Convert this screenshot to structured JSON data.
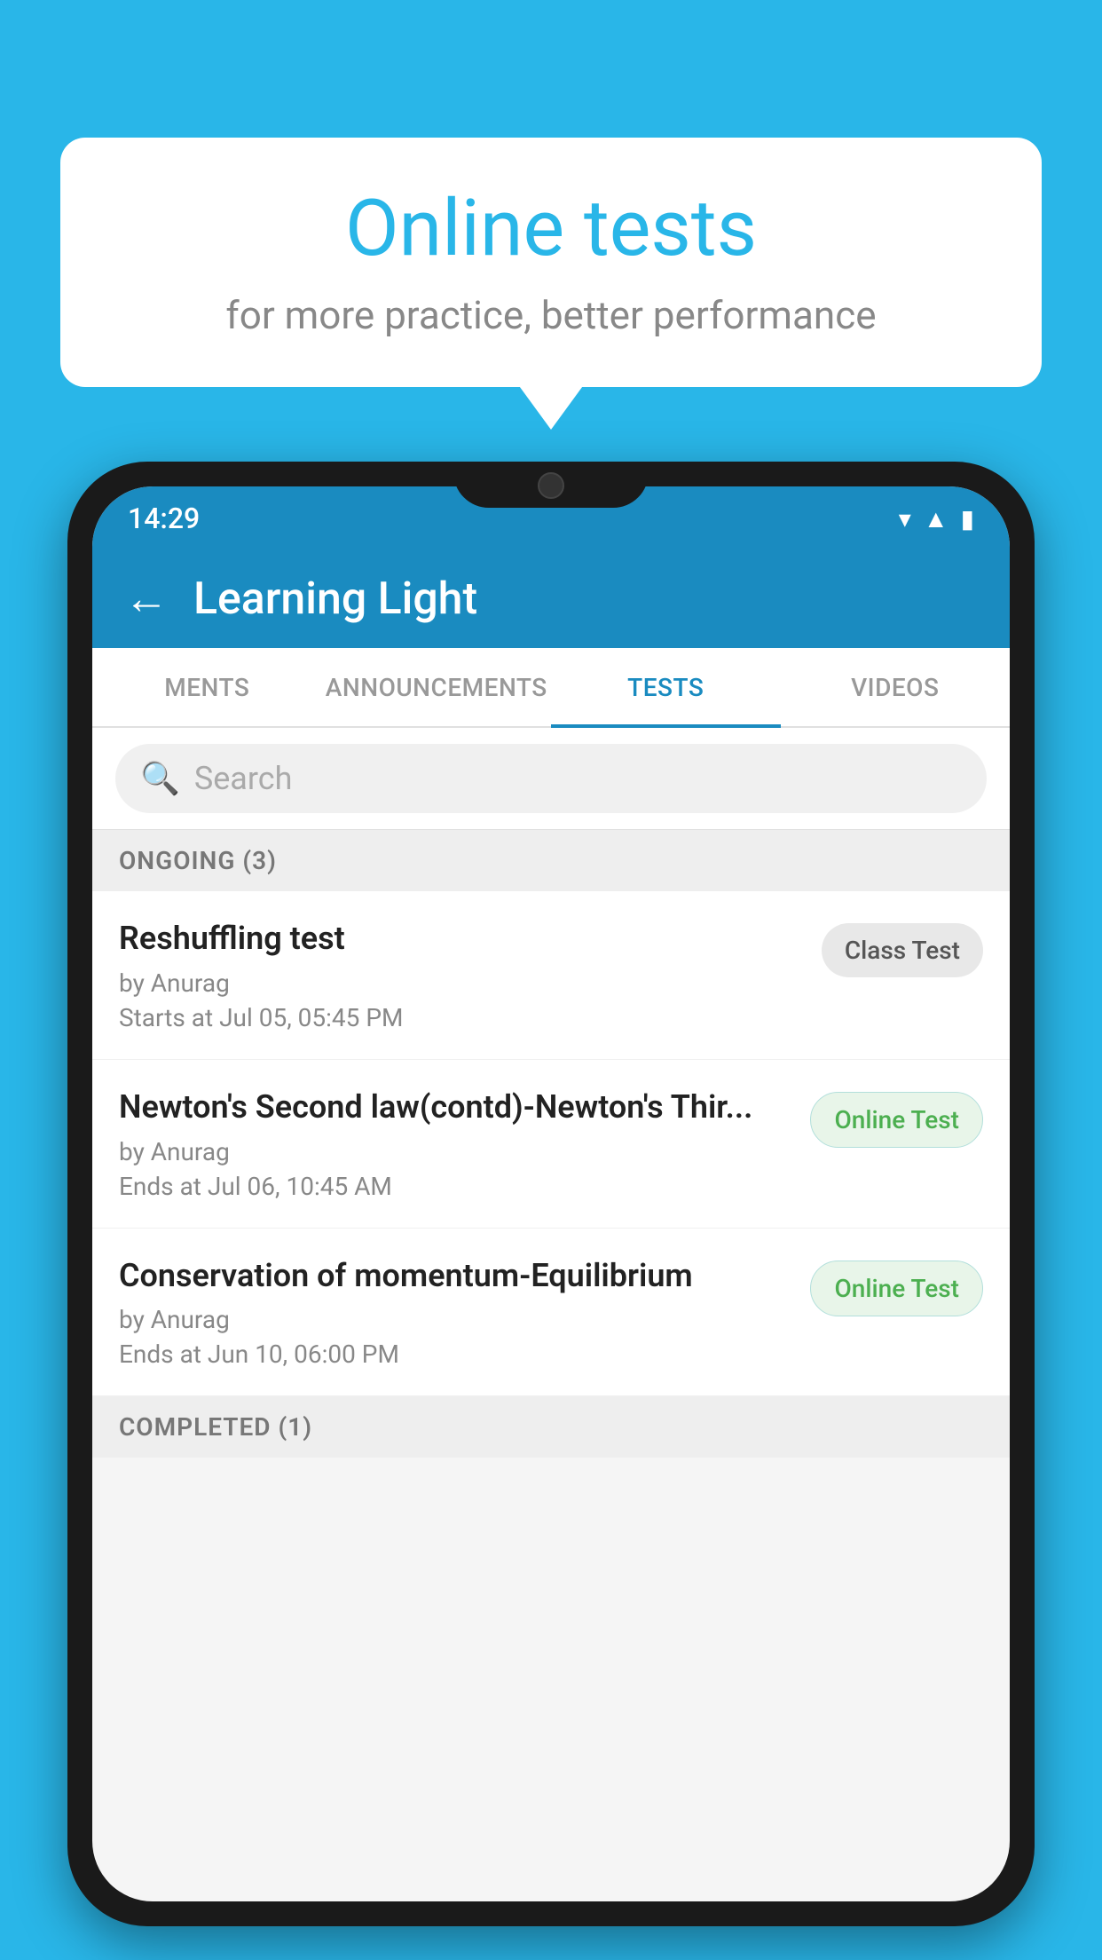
{
  "background_color": "#29b6e8",
  "speech_bubble": {
    "title": "Online tests",
    "subtitle": "for more practice, better performance"
  },
  "phone": {
    "status_bar": {
      "time": "14:29",
      "icons": [
        "wifi",
        "signal",
        "battery"
      ]
    },
    "app_bar": {
      "title": "Learning Light",
      "back_label": "←"
    },
    "tabs": [
      {
        "label": "MENTS",
        "active": false
      },
      {
        "label": "ANNOUNCEMENTS",
        "active": false
      },
      {
        "label": "TESTS",
        "active": true
      },
      {
        "label": "VIDEOS",
        "active": false
      }
    ],
    "search": {
      "placeholder": "Search"
    },
    "sections": [
      {
        "title": "ONGOING (3)",
        "items": [
          {
            "name": "Reshuffling test",
            "author": "by Anurag",
            "time": "Starts at  Jul 05, 05:45 PM",
            "badge": "Class Test",
            "badge_type": "class"
          },
          {
            "name": "Newton's Second law(contd)-Newton's Thir...",
            "author": "by Anurag",
            "time": "Ends at  Jul 06, 10:45 AM",
            "badge": "Online Test",
            "badge_type": "online"
          },
          {
            "name": "Conservation of momentum-Equilibrium",
            "author": "by Anurag",
            "time": "Ends at  Jun 10, 06:00 PM",
            "badge": "Online Test",
            "badge_type": "online"
          }
        ]
      }
    ],
    "completed_section_title": "COMPLETED (1)"
  }
}
